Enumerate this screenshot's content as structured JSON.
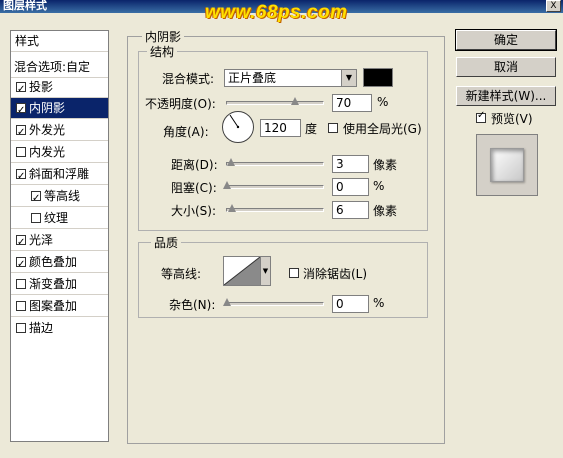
{
  "window": {
    "title": "图层样式",
    "watermark": "www.68ps.com",
    "close_label": "X"
  },
  "styles_panel": {
    "header": "样式",
    "blend_options": "混合选项:自定",
    "items": [
      {
        "label": "投影",
        "checked": true
      },
      {
        "label": "内阴影",
        "checked": true,
        "selected": true
      },
      {
        "label": "外发光",
        "checked": true
      },
      {
        "label": "内发光",
        "checked": false
      },
      {
        "label": "斜面和浮雕",
        "checked": true
      },
      {
        "label": "等高线",
        "checked": true
      },
      {
        "label": "纹理",
        "checked": false
      },
      {
        "label": "光泽",
        "checked": true
      },
      {
        "label": "颜色叠加",
        "checked": true
      },
      {
        "label": "渐变叠加",
        "checked": false
      },
      {
        "label": "图案叠加",
        "checked": false
      },
      {
        "label": "描边",
        "checked": false
      }
    ]
  },
  "inner_shadow": {
    "title": "内阴影",
    "structure": {
      "title": "结构",
      "blend_mode_label": "混合模式:",
      "blend_mode_value": "正片叠底",
      "shadow_color": "#000000",
      "opacity_label": "不透明度(O):",
      "opacity_value": "70",
      "opacity_unit": "%",
      "angle_label": "角度(A):",
      "angle_value": "120",
      "angle_unit": "度",
      "global_light_label": "使用全局光(G)",
      "global_light_checked": false,
      "distance_label": "距离(D):",
      "distance_value": "3",
      "distance_unit": "像素",
      "choke_label": "阻塞(C):",
      "choke_value": "0",
      "choke_unit": "%",
      "size_label": "大小(S):",
      "size_value": "6",
      "size_unit": "像素"
    },
    "quality": {
      "title": "品质",
      "contour_label": "等高线:",
      "antialias_label": "消除锯齿(L)",
      "antialias_checked": false,
      "noise_label": "杂色(N):",
      "noise_value": "0",
      "noise_unit": "%"
    }
  },
  "buttons": {
    "ok": "确定",
    "cancel": "取消",
    "new_style": "新建样式(W)...",
    "preview_label": "预览(V)",
    "preview_checked": true
  }
}
